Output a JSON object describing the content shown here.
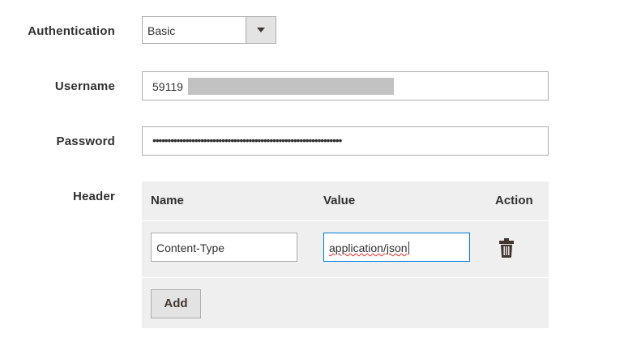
{
  "form": {
    "authentication": {
      "label": "Authentication",
      "value": "Basic"
    },
    "username": {
      "label": "Username",
      "value": "59119"
    },
    "password": {
      "label": "Password",
      "value": "•••••••••••••••••••••••••••••••••••••••••••••••••••••••••••••••"
    },
    "header": {
      "label": "Header",
      "columns": {
        "name": "Name",
        "value": "Value",
        "action": "Action"
      },
      "rows": [
        {
          "name": "Content-Type",
          "value": "application/json"
        }
      ],
      "add_label": "Add"
    }
  },
  "icons": {
    "dropdown": "chevron-down-icon",
    "delete": "trash-icon"
  }
}
